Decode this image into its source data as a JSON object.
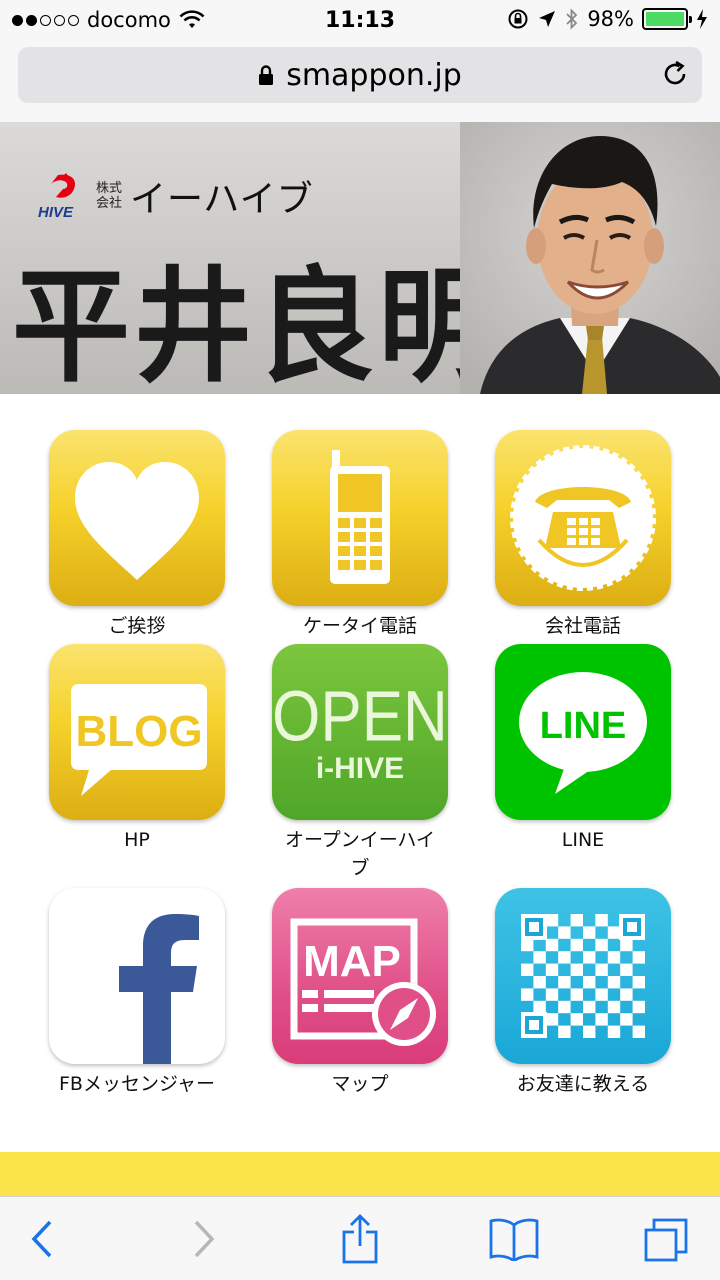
{
  "status_bar": {
    "carrier": "docomo",
    "time": "11:13",
    "battery": "98%",
    "battery_level": 0.98,
    "signal_bars_filled": 2,
    "signal_bars_total": 5
  },
  "url_bar": {
    "domain": "smappon.jp"
  },
  "banner": {
    "company_prefix_1": "株式",
    "company_prefix_2": "会社",
    "company_name": "イーハイブ",
    "person_name": "平井良明"
  },
  "apps": [
    {
      "label": "ご挨拶",
      "icon": "heart-icon"
    },
    {
      "label": "ケータイ電話",
      "icon": "mobile-phone-icon"
    },
    {
      "label": "会社電話",
      "icon": "telephone-icon"
    },
    {
      "label": "HP",
      "icon": "blog-icon",
      "icon_text": "BLOG"
    },
    {
      "label": "オープンイーハイブ",
      "icon": "open-ihive-icon",
      "icon_text_1": "OPEN",
      "icon_text_2": "i-HIVE"
    },
    {
      "label": "LINE",
      "icon": "line-icon",
      "icon_text": "LINE"
    },
    {
      "label": "FBメッセンジャー",
      "icon": "facebook-icon",
      "icon_text": "f"
    },
    {
      "label": "マップ",
      "icon": "map-icon",
      "icon_text": "MAP"
    },
    {
      "label": "お友達に教える",
      "icon": "qr-code-icon"
    }
  ],
  "colors": {
    "gold": "#f5d12b",
    "line_green": "#00c300",
    "facebook_blue": "#3b5998",
    "map_pink": "#e2528c",
    "qr_cyan": "#29b6de",
    "ios_blue": "#1a73e8"
  }
}
